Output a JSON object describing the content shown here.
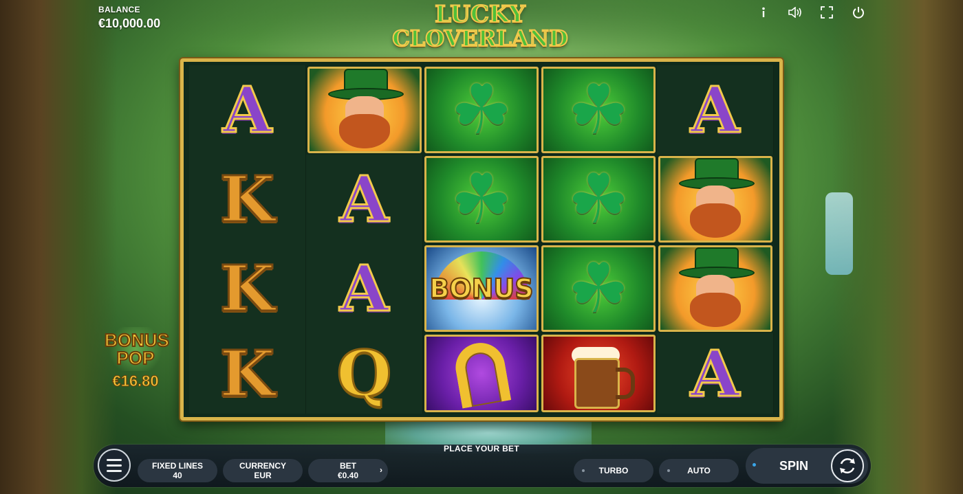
{
  "header": {
    "balance_label": "BALANCE",
    "balance_value": "€10,000.00",
    "icons": [
      "info-icon",
      "sound-icon",
      "fullscreen-icon",
      "power-icon"
    ]
  },
  "logo": {
    "line1": "LUCKY",
    "line2": "CLOVERLAND"
  },
  "reels": {
    "rows": [
      [
        "A",
        "leprechaun",
        "clover",
        "clover",
        "A"
      ],
      [
        "K",
        "A",
        "clover",
        "clover",
        "leprechaun"
      ],
      [
        "K",
        "A",
        "bonus",
        "clover",
        "leprechaun"
      ],
      [
        "K",
        "Q",
        "horseshoe",
        "beer-mug",
        "A"
      ]
    ],
    "bonus_text": "BONUS"
  },
  "bonus_pop": {
    "title_line1": "BONUS",
    "title_line2": "POP",
    "amount": "€16.80"
  },
  "controls": {
    "title": "PLACE YOUR BET",
    "fixed_lines_label": "FIXED LINES",
    "fixed_lines_value": "40",
    "currency_label": "CURRENCY",
    "currency_value": "EUR",
    "bet_label": "BET",
    "bet_value": "€0.40",
    "turbo_label": "TURBO",
    "auto_label": "AUTO",
    "spin_label": "SPIN"
  },
  "colors": {
    "frame_gold": "#d9b44a",
    "letter_A": "#8a45c9",
    "letter_K": "#e49a2e",
    "letter_Q": "#f0c030",
    "control_bg": "#2b3641"
  }
}
